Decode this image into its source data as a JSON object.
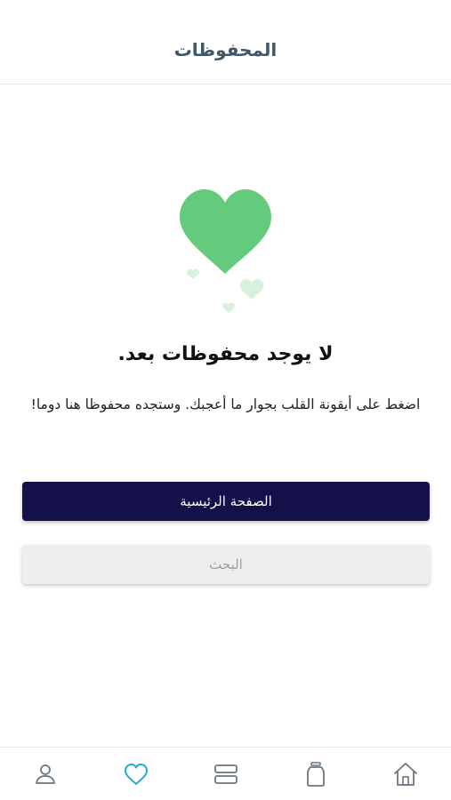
{
  "header": {
    "title": "المحفوظات"
  },
  "empty_state": {
    "illustration_icon": "hearts-illustration",
    "accent_color": "#63cb7b",
    "title": "لا يوجد محفوظات بعد.",
    "description": "اضغط على أيقونة القلب بجوار ما أعجبك. وستجده محفوظا هنا دوما!"
  },
  "actions": {
    "home_label": "الصفحة الرئيسية",
    "search_label": "البحث"
  },
  "tabbar": {
    "active_color": "#2aa6d8",
    "inactive_color": "#6b7680",
    "items": [
      {
        "icon": "profile-icon",
        "active": false
      },
      {
        "icon": "heart-icon",
        "active": true
      },
      {
        "icon": "list-icon",
        "active": false
      },
      {
        "icon": "jar-icon",
        "active": false
      },
      {
        "icon": "home-icon",
        "active": false
      }
    ]
  }
}
